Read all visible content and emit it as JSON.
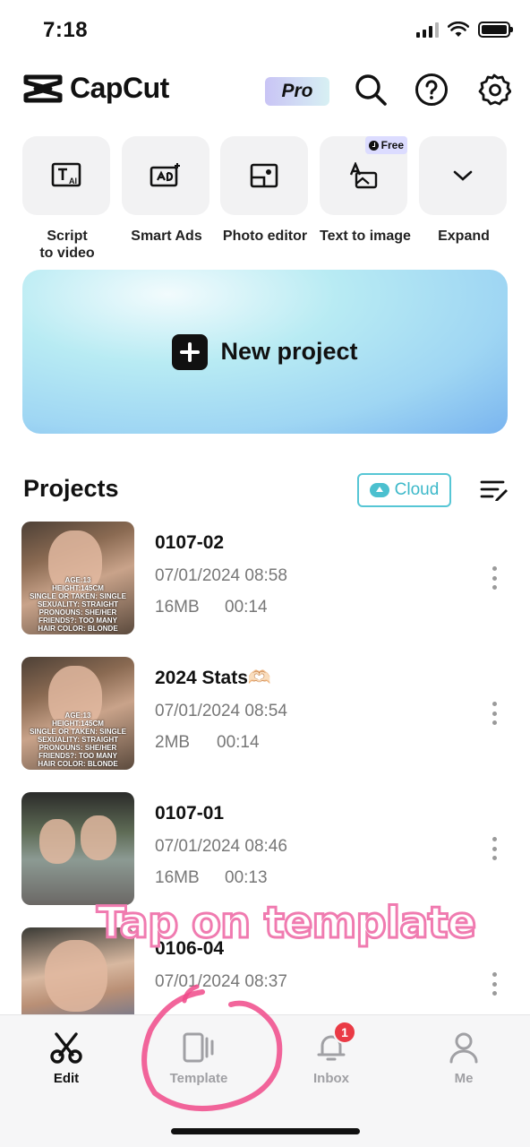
{
  "status_bar": {
    "time": "7:18"
  },
  "header": {
    "app_name": "CapCut",
    "pro_label": "Pro"
  },
  "tools": [
    {
      "label": "Script\nto video",
      "icon": "text-ai-icon"
    },
    {
      "label": "Smart Ads",
      "icon": "smart-ads-icon"
    },
    {
      "label": "Photo editor",
      "icon": "photo-editor-icon"
    },
    {
      "label": "Text to image",
      "icon": "text-to-image-icon",
      "badge": "Free"
    },
    {
      "label": "Expand",
      "icon": "chevron-down-icon"
    }
  ],
  "new_project": {
    "label": "New project"
  },
  "projects": {
    "title": "Projects",
    "cloud_label": "Cloud",
    "items": [
      {
        "name": "0107-02",
        "date": "07/01/2024 08:58",
        "size": "16MB",
        "duration": "00:14",
        "caption": "AGE:13\nHEIGHT:145CM\nSINGLE OR TAKEN: SINGLE\nSEXUALITY: STRAIGHT\nPRONOUNS: SHE/HER\nFRIENDS?: TOO MANY\nHAIR COLOR: BLONDE"
      },
      {
        "name": "2024 Stats🫶🏻",
        "date": "07/01/2024 08:54",
        "size": "2MB",
        "duration": "00:14",
        "caption": "AGE:13\nHEIGHT:145CM\nSINGLE OR TAKEN: SINGLE\nSEXUALITY: STRAIGHT\nPRONOUNS: SHE/HER\nFRIENDS?: TOO MANY\nHAIR COLOR: BLONDE"
      },
      {
        "name": "0107-01",
        "date": "07/01/2024 08:46",
        "size": "16MB",
        "duration": "00:13",
        "caption": ""
      },
      {
        "name": "0106-04",
        "date": "07/01/2024 08:37",
        "size": "",
        "duration": "",
        "caption": ""
      }
    ]
  },
  "annotation": {
    "text": "Tap on template"
  },
  "tab_bar": {
    "tabs": [
      {
        "label": "Edit",
        "active": true
      },
      {
        "label": "Template",
        "active": false
      },
      {
        "label": "Inbox",
        "active": false,
        "badge": "1"
      },
      {
        "label": "Me",
        "active": false
      }
    ]
  },
  "colors": {
    "accent_cloud": "#3cb8c9",
    "annotation_pink": "#f07bb0",
    "badge_red": "#ea3a45"
  }
}
